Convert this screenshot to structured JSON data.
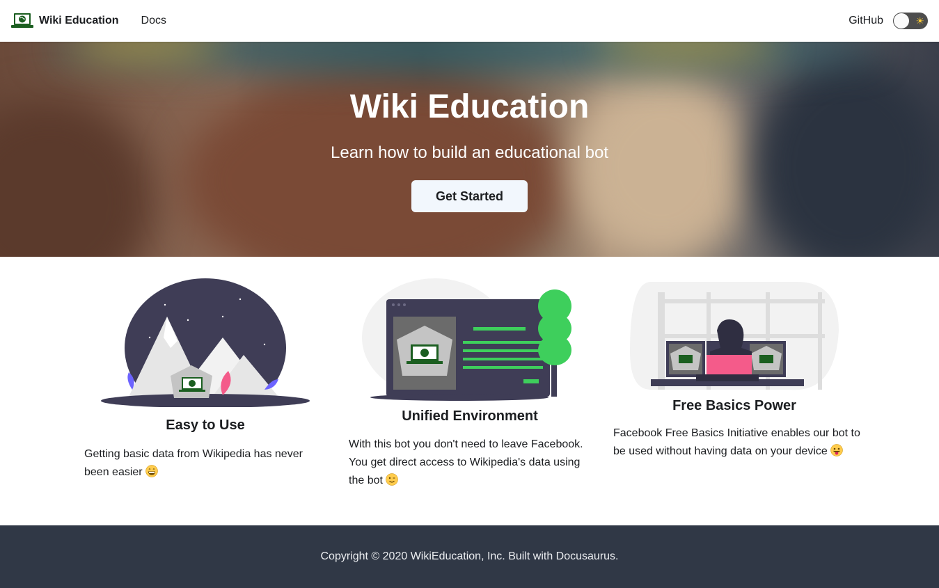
{
  "navbar": {
    "brand_title": "Wiki Education",
    "docs_label": "Docs",
    "github_label": "GitHub",
    "theme_toggle_icon": "sun-icon"
  },
  "hero": {
    "title": "Wiki Education",
    "subtitle": "Learn how to build an educational bot",
    "cta_label": "Get Started"
  },
  "features": [
    {
      "title": "Easy to Use",
      "description": "Getting basic data from Wikipedia has never been easier",
      "emoji": "grinning-face-icon"
    },
    {
      "title": "Unified Environment",
      "description": "With this bot you don't need to leave Facebook. You get direct access to Wikipedia's data using the bot",
      "emoji": "winking-face-icon"
    },
    {
      "title": "Free Basics Power",
      "description": "Facebook Free Basics Initiative enables our bot to be used without having data on your device",
      "emoji": "tongue-out-face-icon"
    }
  ],
  "footer": {
    "copyright": "Copyright © 2020 WikiEducation, Inc. Built with Docusaurus."
  },
  "colors": {
    "navbar_bg": "#ffffff",
    "footer_bg": "#303846",
    "accent_green": "#3ecf5c",
    "illustration_dark": "#3f3d56",
    "cta_bg": "#f2f7fd"
  }
}
